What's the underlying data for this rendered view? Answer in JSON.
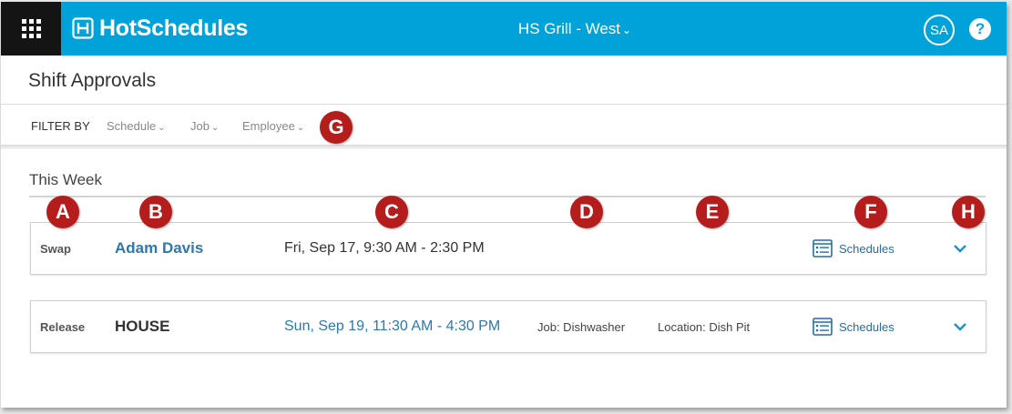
{
  "brand": {
    "name": "HotSchedules"
  },
  "header": {
    "location": "HS Grill - West",
    "avatar_initials": "SA",
    "help_label": "?"
  },
  "page": {
    "title": "Shift Approvals"
  },
  "filters": {
    "label": "FILTER BY",
    "items": [
      "Schedule",
      "Job",
      "Employee"
    ]
  },
  "section": {
    "title": "This Week"
  },
  "requests": [
    {
      "type": "Swap",
      "employee": "Adam Davis",
      "when": "Fri, Sep 17, 9:30 AM - 2:30 PM",
      "job": "",
      "location": "",
      "action": "Schedules"
    },
    {
      "type": "Release",
      "employee": "HOUSE",
      "when": "Sun, Sep 19, 11:30 AM - 4:30 PM",
      "job": "Job: Dishwasher",
      "location": "Location: Dish Pit",
      "action": "Schedules"
    }
  ],
  "callouts": [
    "A",
    "B",
    "C",
    "D",
    "E",
    "F",
    "G",
    "H"
  ],
  "colors": {
    "topbar": "#00a3d9",
    "apps_button": "#141414",
    "link": "#2a7ab0",
    "callout": "#b51c1c"
  },
  "icons": {
    "apps": "grid-icon",
    "brand": "hotschedules-logo-icon",
    "dropdown": "chevron-down-icon",
    "schedules": "schedule-list-icon",
    "expand": "chevron-down-icon"
  }
}
